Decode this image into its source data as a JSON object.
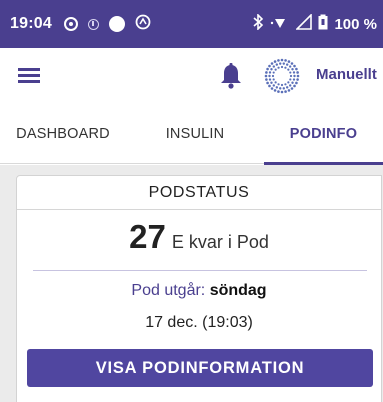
{
  "status_bar": {
    "time": "19:04",
    "battery_text": "100 %",
    "icons_left": [
      "sync-ring-icon",
      "data-saver-icon",
      "circle-icon",
      "nfc-icon"
    ],
    "icons_right": [
      "bluetooth-icon",
      "wifi-icon",
      "signal-icon",
      "battery-icon"
    ]
  },
  "header": {
    "menu_icon": "hamburger-menu-icon",
    "notification_icon": "bell-icon",
    "mode_icon": "automode-sun-icon",
    "mode_label": "Manuellt"
  },
  "tabs": [
    {
      "label": "DASHBOARD",
      "active": false
    },
    {
      "label": "INSULIN",
      "active": false
    },
    {
      "label": "PODINFO",
      "active": true
    }
  ],
  "pod_card": {
    "title": "PODSTATUS",
    "units_value": "27",
    "units_label": "E kvar i Pod",
    "expiry_key": "Pod utgår:",
    "expiry_day": "söndag",
    "expiry_date": "17 dec. (19:03)",
    "button_label": "VISA PODINFORMATION"
  },
  "colors": {
    "brand": "#4a3f8f",
    "button": "#5046a0",
    "background": "#ebebeb"
  }
}
